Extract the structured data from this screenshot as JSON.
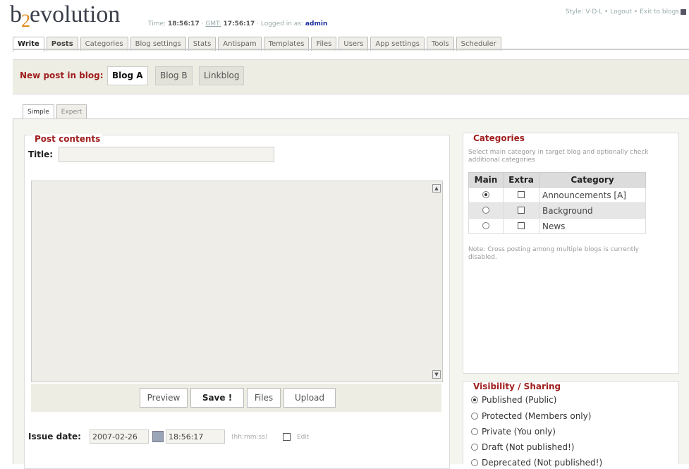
{
  "app": {
    "logo_pre": "b",
    "logo_two": "2",
    "logo_post": "evolution"
  },
  "header": {
    "time_label": "Time:",
    "time": "18:56:17",
    "gmt_label": "GMT:",
    "gmt": "17:56:17",
    "logged_label": "Logged in as:",
    "user": "admin",
    "style": "Style: V·D·L",
    "logout": "Logout",
    "exit": "Exit to blogs"
  },
  "tabs": [
    "Write",
    "Posts",
    "Categories",
    "Blog settings",
    "Stats",
    "Antispam",
    "Templates",
    "Files",
    "Users",
    "App settings",
    "Tools",
    "Scheduler"
  ],
  "blogbar": {
    "label": "New post in blog:",
    "blogs": [
      "Blog A",
      "Blog B",
      "Linkblog"
    ]
  },
  "subtabs": [
    "Simple",
    "Expert"
  ],
  "post": {
    "legend": "Post contents",
    "title_label": "Title:",
    "title_value": "",
    "buttons": {
      "preview": "Preview",
      "save": "Save !",
      "files": "Files",
      "upload": "Upload"
    },
    "issue_label": "Issue date:",
    "date": "2007-02-26",
    "time": "18:56:17",
    "time_hint": "(hh:mm:ss)",
    "edit": "Edit"
  },
  "categories": {
    "legend": "Categories",
    "help": "Select main category in target blog and optionally check additional categories",
    "headers": {
      "main": "Main",
      "extra": "Extra",
      "category": "Category"
    },
    "rows": [
      {
        "name": "Announcements [A]",
        "main": true,
        "extra": false
      },
      {
        "name": "Background",
        "main": false,
        "extra": false
      },
      {
        "name": "News",
        "main": false,
        "extra": false
      }
    ],
    "note": "Note: Cross posting among multiple blogs is currently disabled."
  },
  "visibility": {
    "legend": "Visibility / Sharing",
    "options": [
      "Published (Public)",
      "Protected (Members only)",
      "Private (You only)",
      "Draft (Not published!)",
      "Deprecated (Not published!)"
    ],
    "selected": 0
  }
}
